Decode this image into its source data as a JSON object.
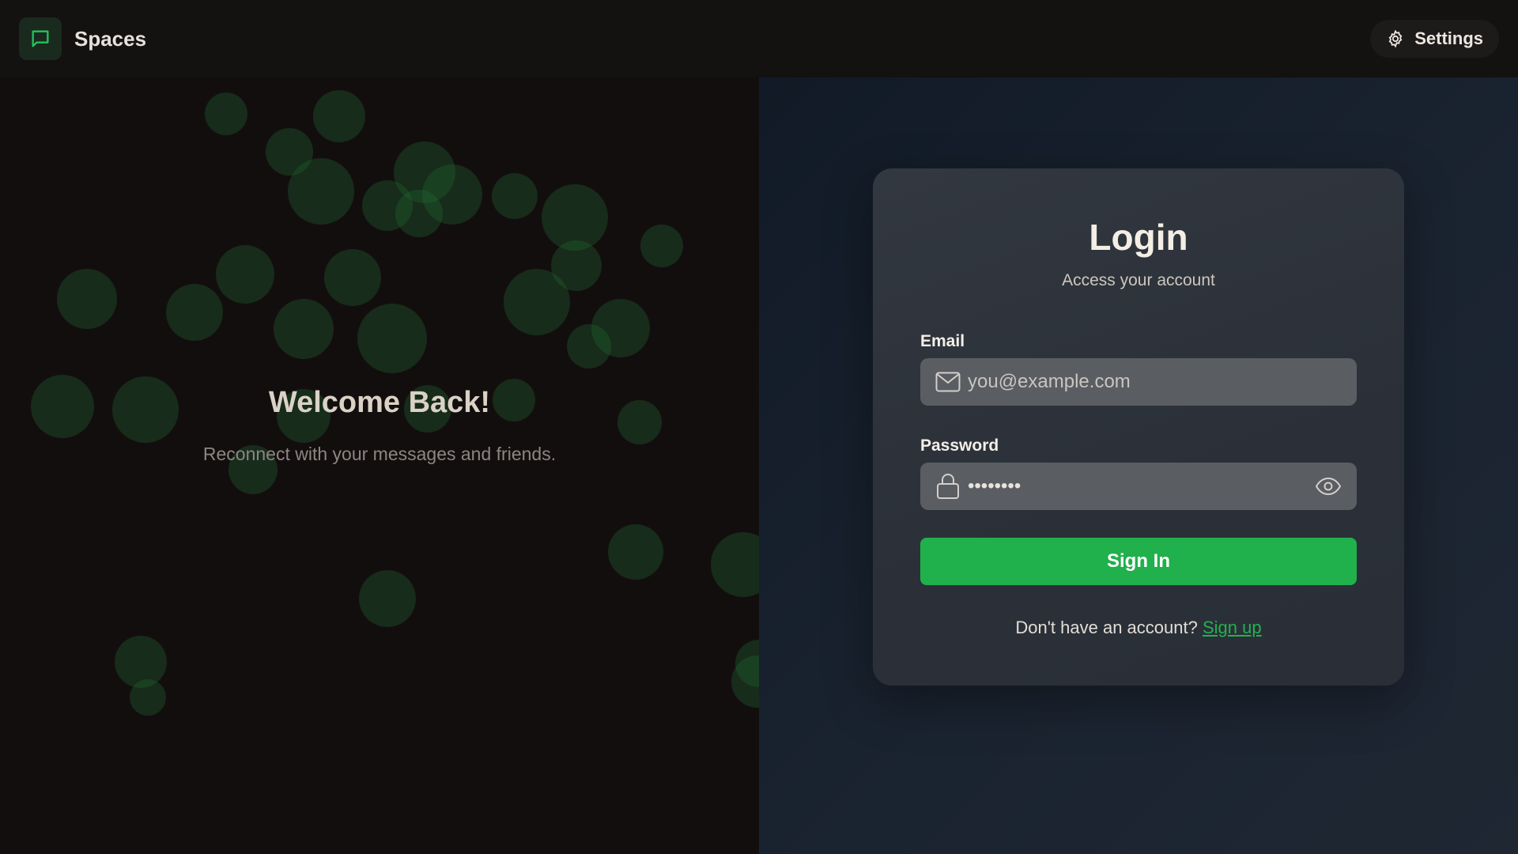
{
  "app": {
    "name": "Spaces"
  },
  "header": {
    "settings_label": "Settings"
  },
  "hero": {
    "title": "Welcome Back!",
    "subtitle": "Reconnect with your messages and friends."
  },
  "login": {
    "title": "Login",
    "subtitle": "Access your account",
    "email": {
      "label": "Email",
      "placeholder": "you@example.com",
      "value": ""
    },
    "password": {
      "label": "Password",
      "value": "password"
    },
    "submit_label": "Sign In",
    "signup_prompt": "Don't have an account?",
    "signup_link": "Sign up"
  },
  "colors": {
    "accent": "#20b04c",
    "link": "#22b24e",
    "card": "#2e333b",
    "input": "#5a5d62"
  },
  "icons": {
    "logo": "chat-bubble-icon",
    "settings": "gear-icon",
    "email": "mail-icon",
    "password": "lock-icon",
    "toggle": "eye-icon"
  }
}
